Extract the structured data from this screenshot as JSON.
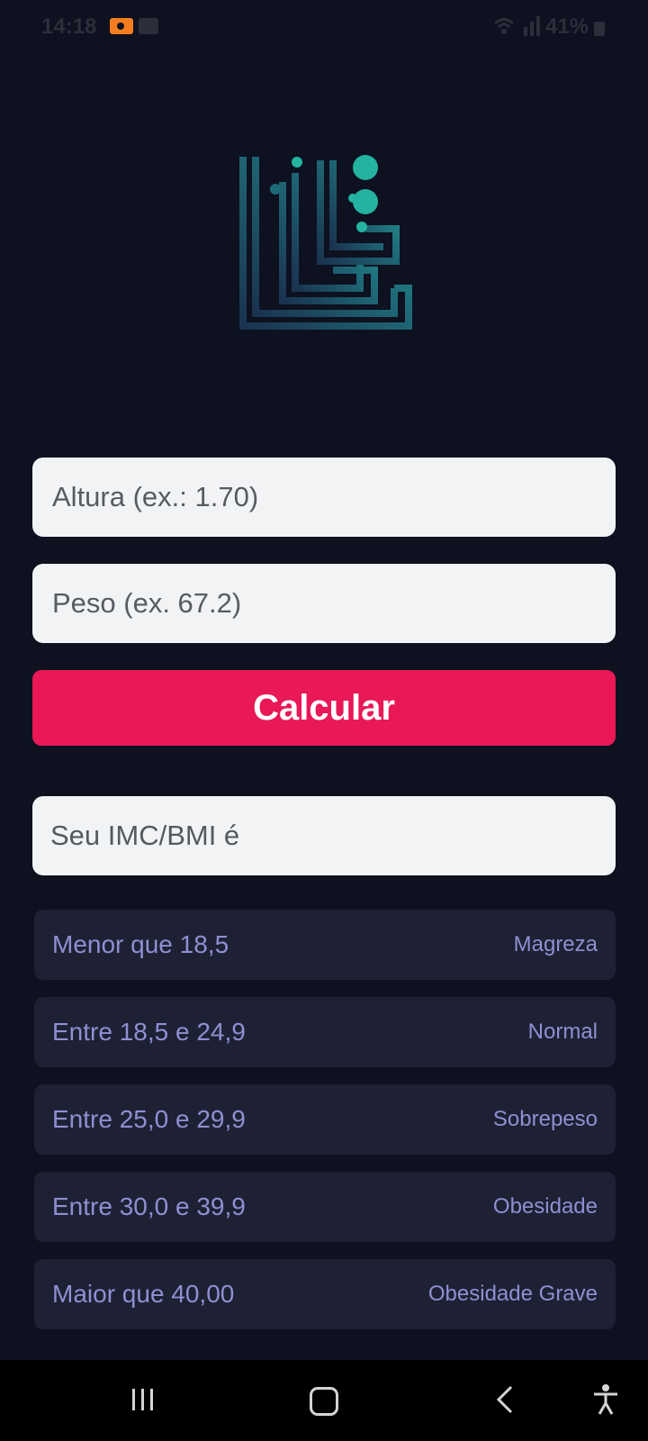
{
  "status_bar": {
    "time": "14:18",
    "battery": "41%"
  },
  "form": {
    "height_placeholder": "Altura (ex.: 1.70)",
    "weight_placeholder": "Peso (ex. 67.2)",
    "calculate_label": "Calcular",
    "result_label": "Seu IMC/BMI é"
  },
  "ranges": [
    {
      "range": "Menor que 18,5",
      "class": "Magreza"
    },
    {
      "range": "Entre 18,5 e 24,9",
      "class": "Normal"
    },
    {
      "range": "Entre 25,0 e 29,9",
      "class": "Sobrepeso"
    },
    {
      "range": "Entre 30,0 e 39,9",
      "class": "Obesidade"
    },
    {
      "range": "Maior que 40,00",
      "class": "Obesidade Grave"
    }
  ],
  "colors": {
    "background": "#0d1120",
    "accent": "#e91857",
    "row_background": "#1e2134",
    "row_text": "#8f8fd2",
    "logo_teal": "#23b3a0"
  },
  "icons": {
    "status": [
      "recording-icon",
      "notification-box-icon",
      "wifi-icon",
      "signal-icon",
      "battery-icon"
    ],
    "nav": [
      "recents-icon",
      "home-icon",
      "back-icon",
      "accessibility-icon"
    ]
  }
}
